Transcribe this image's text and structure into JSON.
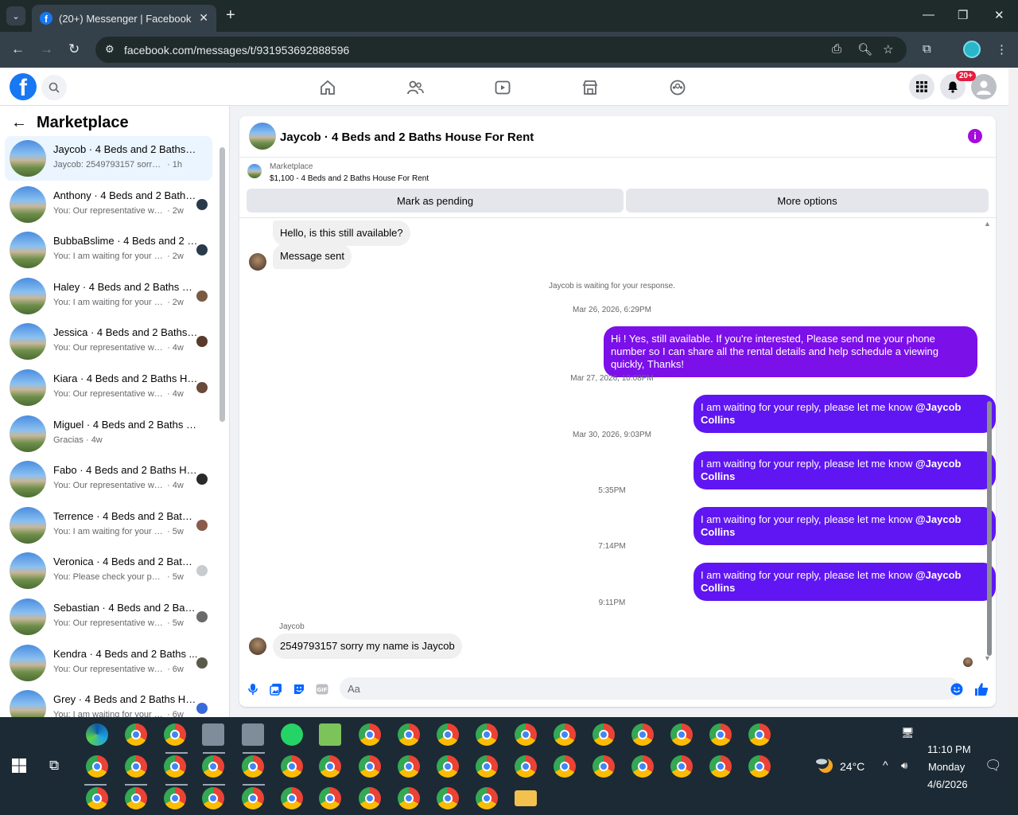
{
  "browser": {
    "tab_title": "(20+) Messenger | Facebook",
    "url": "facebook.com/messages/t/931953692888596"
  },
  "facebook": {
    "notification_badge": "20+"
  },
  "sidebar": {
    "title": "Marketplace",
    "conversations": [
      {
        "name": "Jaycob · 4 Beds and 2 Baths Ho...",
        "preview": "Jaycob: 2549793157 sorry my nam...",
        "time": "· 1h"
      },
      {
        "name": "Anthony · 4 Beds and 2 Baths...",
        "preview": "You: Our representative will con...",
        "time": "· 2w"
      },
      {
        "name": "BubbaBslime · 4 Beds and 2 Bat...",
        "preview": "You: I am waiting for your reply, pl...",
        "time": "· 2w"
      },
      {
        "name": "Haley · 4 Beds and 2 Baths H...",
        "preview": "You: I am waiting for your reply,...",
        "time": "· 2w"
      },
      {
        "name": "Jessica · 4 Beds and 2 Baths ...",
        "preview": "You: Our representative will con...",
        "time": "· 4w"
      },
      {
        "name": "Kiara · 4 Beds and 2 Baths Ho...",
        "preview": "You: Our representative will con...",
        "time": "· 4w"
      },
      {
        "name": "Miguel · 4 Beds and 2 Baths Ho...",
        "preview": "Gracias",
        "time": "· 4w"
      },
      {
        "name": "Fabo · 4 Beds and 2 Baths Ho...",
        "preview": "You: Our representative will con...",
        "time": "· 4w"
      },
      {
        "name": "Terrence · 4 Beds and 2 Baths...",
        "preview": "You: I am waiting for your reply,...",
        "time": "· 5w"
      },
      {
        "name": "Veronica · 4 Beds and 2 Baths...",
        "preview": "You: Please check your phone, I...",
        "time": "· 5w"
      },
      {
        "name": "Sebastian · 4 Beds and 2 Bath...",
        "preview": "You: Our representative will con...",
        "time": "· 5w"
      },
      {
        "name": "Kendra · 4 Beds and 2 Baths ...",
        "preview": "You: Our representative will con...",
        "time": "· 6w"
      },
      {
        "name": "Grey · 4 Beds and 2 Baths Hous...",
        "preview": "You: I am waiting for your reply, pl...",
        "time": "· 6w"
      }
    ]
  },
  "chat": {
    "title": "Jaycob · 4 Beds and 2 Baths House For Rent",
    "marketplace_label": "Marketplace",
    "listing": "$1,100 - 4 Beds and 2 Baths House For Rent",
    "mark_pending": "Mark as pending",
    "more_options": "More options",
    "msg_hello": "Hello, is this still available?",
    "msg_sent": "Message sent",
    "waiting_note": "Jaycob is waiting for your response.",
    "ts1": "Mar 26, 2026, 6:29PM",
    "reply1": "Hi ! Yes, still available. If you're interested, Please send me your phone number so I can share all the rental details and help schedule a viewing quickly, Thanks!",
    "ts2": "Mar 27, 2026, 10:08PM",
    "ts3": "Mar 30, 2026, 9:03PM",
    "ts4": "5:35PM",
    "ts5": "7:14PM",
    "ts6": "9:11PM",
    "waiting_text": "I am waiting for your reply, please let me know ",
    "mention": "@Jaycob Collins",
    "sender_name": "Jaycob",
    "last_msg": "2549793157 sorry my name is Jaycob",
    "input_placeholder": "Aa"
  },
  "taskbar": {
    "temperature": "24°C",
    "time": "11:10 PM",
    "day": "Monday",
    "date": "4/6/2026"
  },
  "colors": {
    "accent": "#1877f2",
    "outgoing_bubble": "#7c10e8",
    "info_icon": "#a50cd9"
  }
}
